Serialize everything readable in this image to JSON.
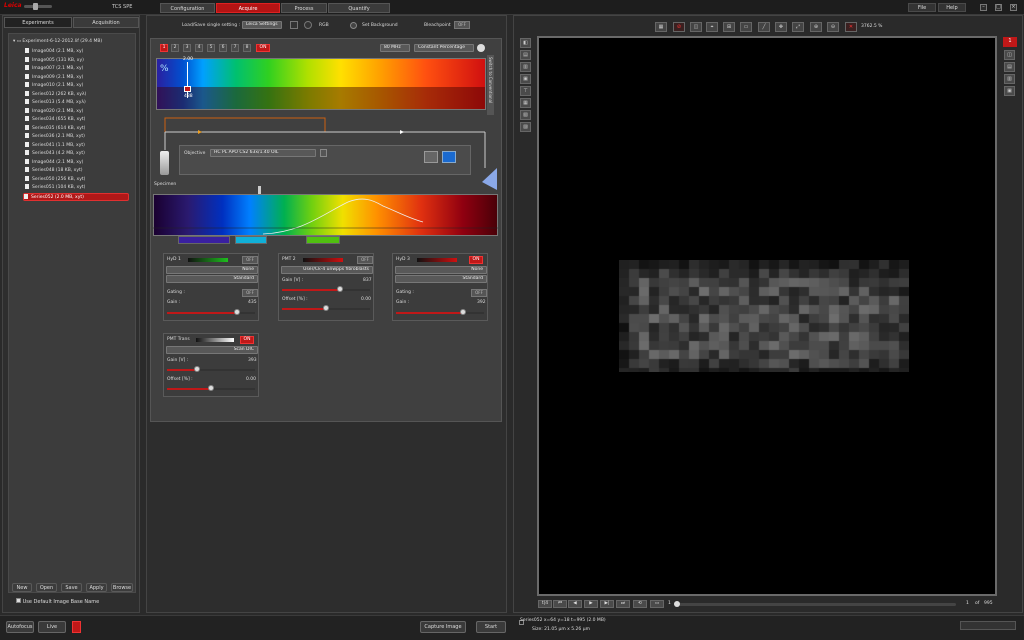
{
  "topbar": {
    "system": "TCS SPE",
    "modes": [
      "Configuration",
      "Acquire",
      "Process",
      "Quantify"
    ],
    "active_mode": "Acquire",
    "file_menu": "File",
    "help_menu": "Help"
  },
  "left": {
    "tabs": [
      "Experiments",
      "Acquisition"
    ],
    "experiment": "Experiment-6-12-2012.lif (29.4 MB)",
    "items": [
      "Image004 (2.1 MB, xy)",
      "Image005 (131 KB, xy)",
      "Image007 (2.1 MB, xy)",
      "Image009 (2.1 MB, xy)",
      "Image010 (2.1 MB, xy)",
      "Series012 (262 KB, xyλ)",
      "Series013 (5.4 MB, xyλ)",
      "Image020 (2.1 MB, xy)",
      "Series034 (655 KB, xyt)",
      "Series035 (614 KB, xyt)",
      "Series036 (2.1 MB, xyt)",
      "Series041 (1.1 MB, xyt)",
      "Series043 (4.2 MB, xyt)",
      "Image044 (2.1 MB, xy)",
      "Series048 (18 KB, xyt)",
      "Series050 (256 KB, xyt)",
      "Series051 (104 KB, xyt)",
      "Series052 (2.0 MB, xyt)"
    ],
    "selected_index": 17,
    "buttons": [
      "New",
      "Open",
      "Save",
      "Apply",
      "Browse"
    ],
    "default_name_label": "Use Default Image Base Name"
  },
  "acquire": {
    "load_save_label": "Load/Save single setting :",
    "settings_value": "Leica Settings",
    "rgb_label": "RGB",
    "set_background_label": "Set Background",
    "bleachpoint_label": "Bleachpoint",
    "off": "OFF",
    "on": "ON",
    "lines": [
      "1",
      "2",
      "3",
      "4",
      "5",
      "6",
      "7",
      "8"
    ],
    "freq": "80 MHz",
    "mode": "Constant Percentage",
    "percent_symbol": "%",
    "marker_value": "2.00",
    "marker_wl": "488",
    "objective_label": "Objective",
    "objective_value": "HC PL APO CS2   63x/1.40 OIL",
    "specimen_label": "Specimen",
    "switch_label": "Switch to Conventional"
  },
  "detectors": [
    {
      "name": "HyD 1",
      "state": "OFF",
      "lut": "None",
      "mode": "Standard",
      "gating_label": "Gating :",
      "gain_label": "Gain :",
      "gain_value": "435",
      "gain_pct": 0.8,
      "color": "#1ec01e"
    },
    {
      "name": "PMT 2",
      "state": "OFF",
      "lut": "User/Ck-4 unwpps fibroblasts",
      "mode": "",
      "gain_label": "Gain [V] :",
      "gain_value": "837",
      "gain_pct": 0.66,
      "offset_label": "Offset [%] :",
      "offset_value": "0.00",
      "offset_pct": 0.5,
      "color": "#d01010"
    },
    {
      "name": "HyD 3",
      "state": "ON",
      "lut": "None",
      "mode": "Standard",
      "gating_label": "Gating :",
      "gain_label": "Gain :",
      "gain_value": "392",
      "gain_pct": 0.76,
      "color": "#d01010"
    },
    {
      "name": "PMT Trans",
      "state": "ON",
      "lut": "Scan DIC",
      "mode": "",
      "gain_label": "Gain [V] :",
      "gain_value": "393",
      "gain_pct": 0.34,
      "offset_label": "Offset [%] :",
      "offset_value": "0.00",
      "offset_pct": 0.5,
      "color": "#ffffff"
    }
  ],
  "viewer": {
    "zoom": "3762.5 %",
    "frame_current": "1",
    "frame_of": "of",
    "frame_total": "995",
    "channel_indicator": "1",
    "status_line1": "Series052 x=64 y=18 t=995  (2.0 MB)",
    "status_line2": "Size: 21.05 µm x 5.26 µm"
  },
  "bottom": {
    "autofocus": "Autofocus",
    "live": "Live",
    "capture": "Capture Image",
    "start": "Start"
  },
  "colors": {
    "accent": "#c01818",
    "background": "#2a2a2a",
    "panel": "#404040"
  }
}
